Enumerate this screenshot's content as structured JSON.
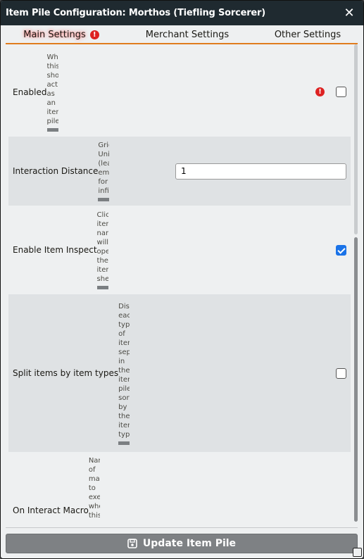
{
  "window": {
    "title": "Item Pile Configuration: Morthos (Tiefling Sorcerer)",
    "close_icon": "close-icon"
  },
  "tabs": [
    {
      "label": "Main Settings",
      "active": true,
      "error_icon": "!"
    },
    {
      "label": "Merchant Settings",
      "active": false
    },
    {
      "label": "Other Settings",
      "active": false
    }
  ],
  "settings": [
    {
      "label": "Enabled",
      "hint": "When this should act as an item pile",
      "control": "checkbox",
      "checked": false,
      "warning_icon": "!"
    },
    {
      "label": "Interaction Distance",
      "hint": "Grid Units (leave empty for infinite)",
      "control": "text",
      "value": "1"
    },
    {
      "label": "Enable Item Inspect",
      "hint": "Click item names will open the item sheet",
      "control": "checkbox",
      "checked": true
    },
    {
      "label": "Split items by item types",
      "hint": "Display each type of item separately in the item pile, sorted by the item type",
      "control": "checkbox",
      "checked": false
    },
    {
      "label": "On Interact Macro",
      "hint": "Name of macro to execute when this",
      "control": "none"
    }
  ],
  "footer": {
    "button_label": "Update Item Pile",
    "button_icon": "save-icon"
  },
  "colors": {
    "titlebar": "#1f2a30",
    "tab_underline": "#e07c1e",
    "checkbox_checked": "#1a73e8",
    "error": "#dd2222",
    "button": "#7e8184"
  }
}
